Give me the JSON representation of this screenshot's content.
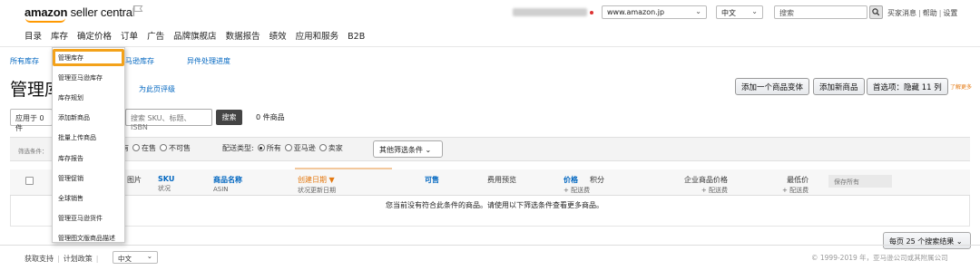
{
  "header": {
    "logo_part1": "amazon",
    "logo_part2": " seller central",
    "marketplace": "www.amazon.jp",
    "language": "中文",
    "search_placeholder": "搜索",
    "top_links": [
      "买家消息",
      "帮助",
      "设置"
    ]
  },
  "main_nav": [
    "目录",
    "库存",
    "确定价格",
    "订单",
    "广告",
    "品牌旗舰店",
    "数据报告",
    "绩效",
    "应用和服务",
    "B2B"
  ],
  "sub_nav": {
    "all_inventory": "所有库存",
    "fba_inventory": "马逊库存",
    "exception": "异件处理进度"
  },
  "page": {
    "title": "管理库",
    "rate_link": "为此页评级",
    "buttons": {
      "add_variation": "添加一个商品变体",
      "add_product": "添加新商品",
      "preferences": "首选项：隐藏 11 列"
    },
    "learn_more": "了解更多"
  },
  "filters": {
    "apply_to": "应用于 0 件",
    "search_placeholder": "搜索 SKU、标题、ISBN",
    "search_button": "搜索",
    "result_count": "0 件商品",
    "filter_label": "筛选条件：",
    "status_options": [
      "有",
      "在售",
      "不可售"
    ],
    "fulfillment_label": "配送类型:",
    "fulfillment_options": [
      "所有",
      "亚马逊",
      "卖家"
    ],
    "more_filters": "其他筛选条件"
  },
  "table": {
    "headers": {
      "image": "图片",
      "sku": "SKU",
      "sku_sub": "状况",
      "name": "商品名称",
      "name_sub": "ASIN",
      "created": "创建日期",
      "created_sub": "状况更新日期",
      "available": "可售",
      "fees": "费用预览",
      "price": "价格",
      "price_sub": "+ 配送费",
      "points": "积分",
      "business_price": "企业商品价格",
      "business_sub": "+ 配送费",
      "lowest": "最低价",
      "lowest_sub": "+ 配送费",
      "save_all": "保存所有"
    },
    "empty_message": "您当前没有符合此条件的商品。请使用以下筛选条件查看更多商品。",
    "per_page": "每页 25 个搜索结果"
  },
  "footer": {
    "support": "获取支持",
    "policy": "计划政策",
    "language": "中文",
    "copyright": "© 1999-2019 年，亚马逊公司或其附属公司"
  },
  "inventory_menu": [
    "管理库存",
    "管理亚马逊库存",
    "库存规划",
    "添加新商品",
    "批量上传商品",
    "库存报告",
    "管理促销",
    "全球销售",
    "管理亚马逊货件",
    "管理图文版商品描述"
  ],
  "colors": {
    "accent_orange": "#f3a21a",
    "link_blue": "#0066c0"
  }
}
